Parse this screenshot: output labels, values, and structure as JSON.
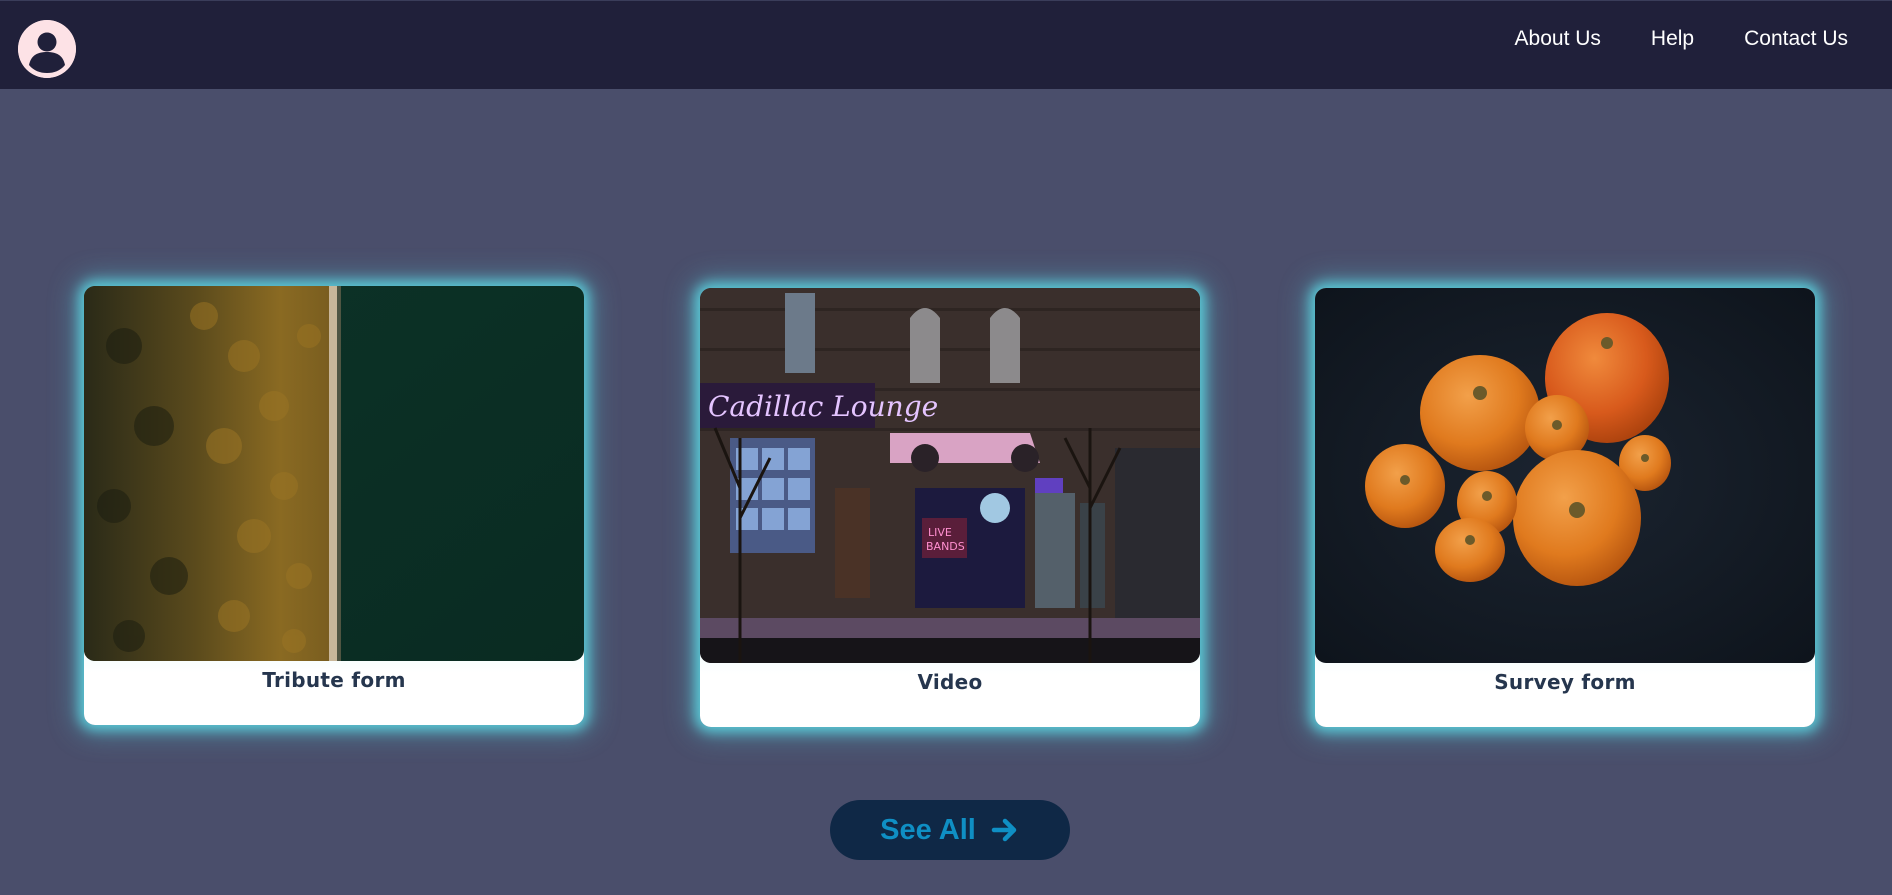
{
  "header": {
    "avatar_icon": "user-avatar-icon",
    "nav": [
      {
        "label": "About Us"
      },
      {
        "label": "Help"
      },
      {
        "label": "Contact Us"
      }
    ]
  },
  "cards": [
    {
      "title": "Tribute form",
      "image": "aerial forest beside dark green water"
    },
    {
      "title": "Video",
      "image": "night street storefront with neon signs"
    },
    {
      "title": "Survey form",
      "image": "orange pumpkins on dark background"
    }
  ],
  "see_all": {
    "label": "See All",
    "icon": "arrow-right-icon"
  },
  "colors": {
    "background": "#4a4e6b",
    "navbar": "#20203a",
    "card_glow": "#5ddde8",
    "button_bg": "#0f2846",
    "button_text": "#0f8fc4"
  }
}
